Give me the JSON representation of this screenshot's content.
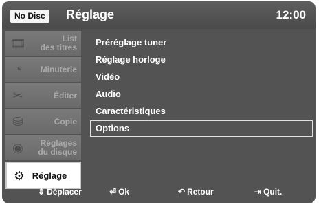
{
  "header": {
    "disc_badge": "No Disc",
    "title": "Réglage",
    "clock": "12:00"
  },
  "sidebar": {
    "items": [
      {
        "label_line1": "List",
        "label_line2": "des titres",
        "icon": "film-strip-icon",
        "glyph": "🎞",
        "active": false
      },
      {
        "label_line1": "Minuterie",
        "label_line2": "",
        "icon": "timer-icon",
        "glyph": "◔",
        "active": false
      },
      {
        "label_line1": "Éditer",
        "label_line2": "",
        "icon": "scissors-icon",
        "glyph": "✂",
        "active": false
      },
      {
        "label_line1": "Copie",
        "label_line2": "",
        "icon": "copy-disc-icon",
        "glyph": "⛁",
        "active": false
      },
      {
        "label_line1": "Réglages",
        "label_line2": "du disque",
        "icon": "disc-settings-icon",
        "glyph": "◉",
        "active": false
      },
      {
        "label_line1": "Réglage",
        "label_line2": "",
        "icon": "gear-icon",
        "glyph": "⚙",
        "active": true
      }
    ]
  },
  "menu": {
    "items": [
      {
        "label": "Préréglage tuner",
        "selected": false
      },
      {
        "label": "Réglage horloge",
        "selected": false
      },
      {
        "label": "Vidéo",
        "selected": false
      },
      {
        "label": "Audio",
        "selected": false
      },
      {
        "label": "Caractéristiques",
        "selected": false
      },
      {
        "label": "Options",
        "selected": true
      }
    ]
  },
  "footer": {
    "move": {
      "icon": "up-down-arrows-icon",
      "glyph": "⇕",
      "label": "Déplacer"
    },
    "ok": {
      "icon": "enter-icon",
      "glyph": "⏎",
      "label": "Ok"
    },
    "back": {
      "icon": "return-arrow-icon",
      "glyph": "↶",
      "label": "Retour"
    },
    "quit": {
      "icon": "exit-door-icon",
      "glyph": "⇥",
      "label": "Quit."
    }
  },
  "colors": {
    "panel_bg": "#535353",
    "sidebar_item_bg": "#707070",
    "active_item_bg": "#ffffff",
    "text_primary": "#ffffff",
    "text_dim": "#a9a9a9"
  }
}
